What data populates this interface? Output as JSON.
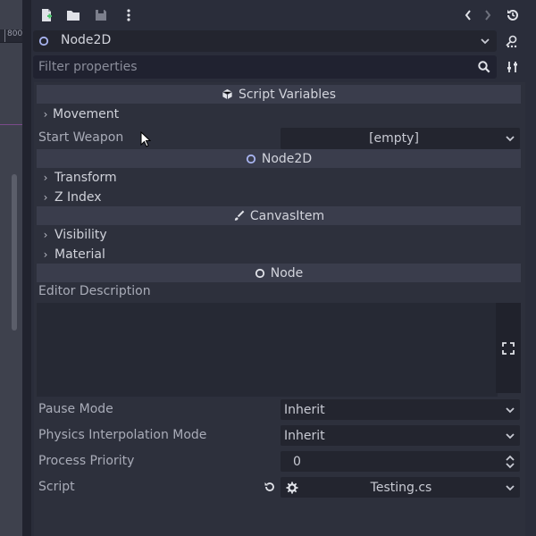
{
  "toolbar": {
    "new_resource_icon": "new-file-icon",
    "open_icon": "folder-open-icon",
    "save_icon": "save-icon",
    "more_icon": "kebab-menu-icon",
    "back_icon": "chevron-left-icon",
    "forward_icon": "chevron-right-icon",
    "history_icon": "history-icon"
  },
  "viewport": {
    "ruler_label": "800"
  },
  "object_selector": {
    "value": "Node2D"
  },
  "filter": {
    "placeholder": "Filter properties"
  },
  "sections": {
    "script_variables": "Script Variables",
    "node2d": "Node2D",
    "canvas_item": "CanvasItem",
    "node": "Node"
  },
  "groups": {
    "movement": "Movement",
    "transform": "Transform",
    "z_index": "Z Index",
    "visibility": "Visibility",
    "material": "Material"
  },
  "properties": {
    "start_weapon": {
      "label": "Start Weapon",
      "value": "[empty]"
    },
    "editor_description": {
      "label": "Editor Description",
      "value": ""
    },
    "pause_mode": {
      "label": "Pause Mode",
      "value": "Inherit"
    },
    "physics_interpolation_mode": {
      "label": "Physics Interpolation Mode",
      "value": "Inherit"
    },
    "process_priority": {
      "label": "Process Priority",
      "value": "0"
    },
    "script": {
      "label": "Script",
      "value": "Testing.cs"
    }
  },
  "colors": {
    "panel_bg": "#2a2d3a",
    "section_bg": "#3a3d4c",
    "field_bg": "#23252f",
    "text": "#c8cad3",
    "label_text": "#a9acb8"
  }
}
